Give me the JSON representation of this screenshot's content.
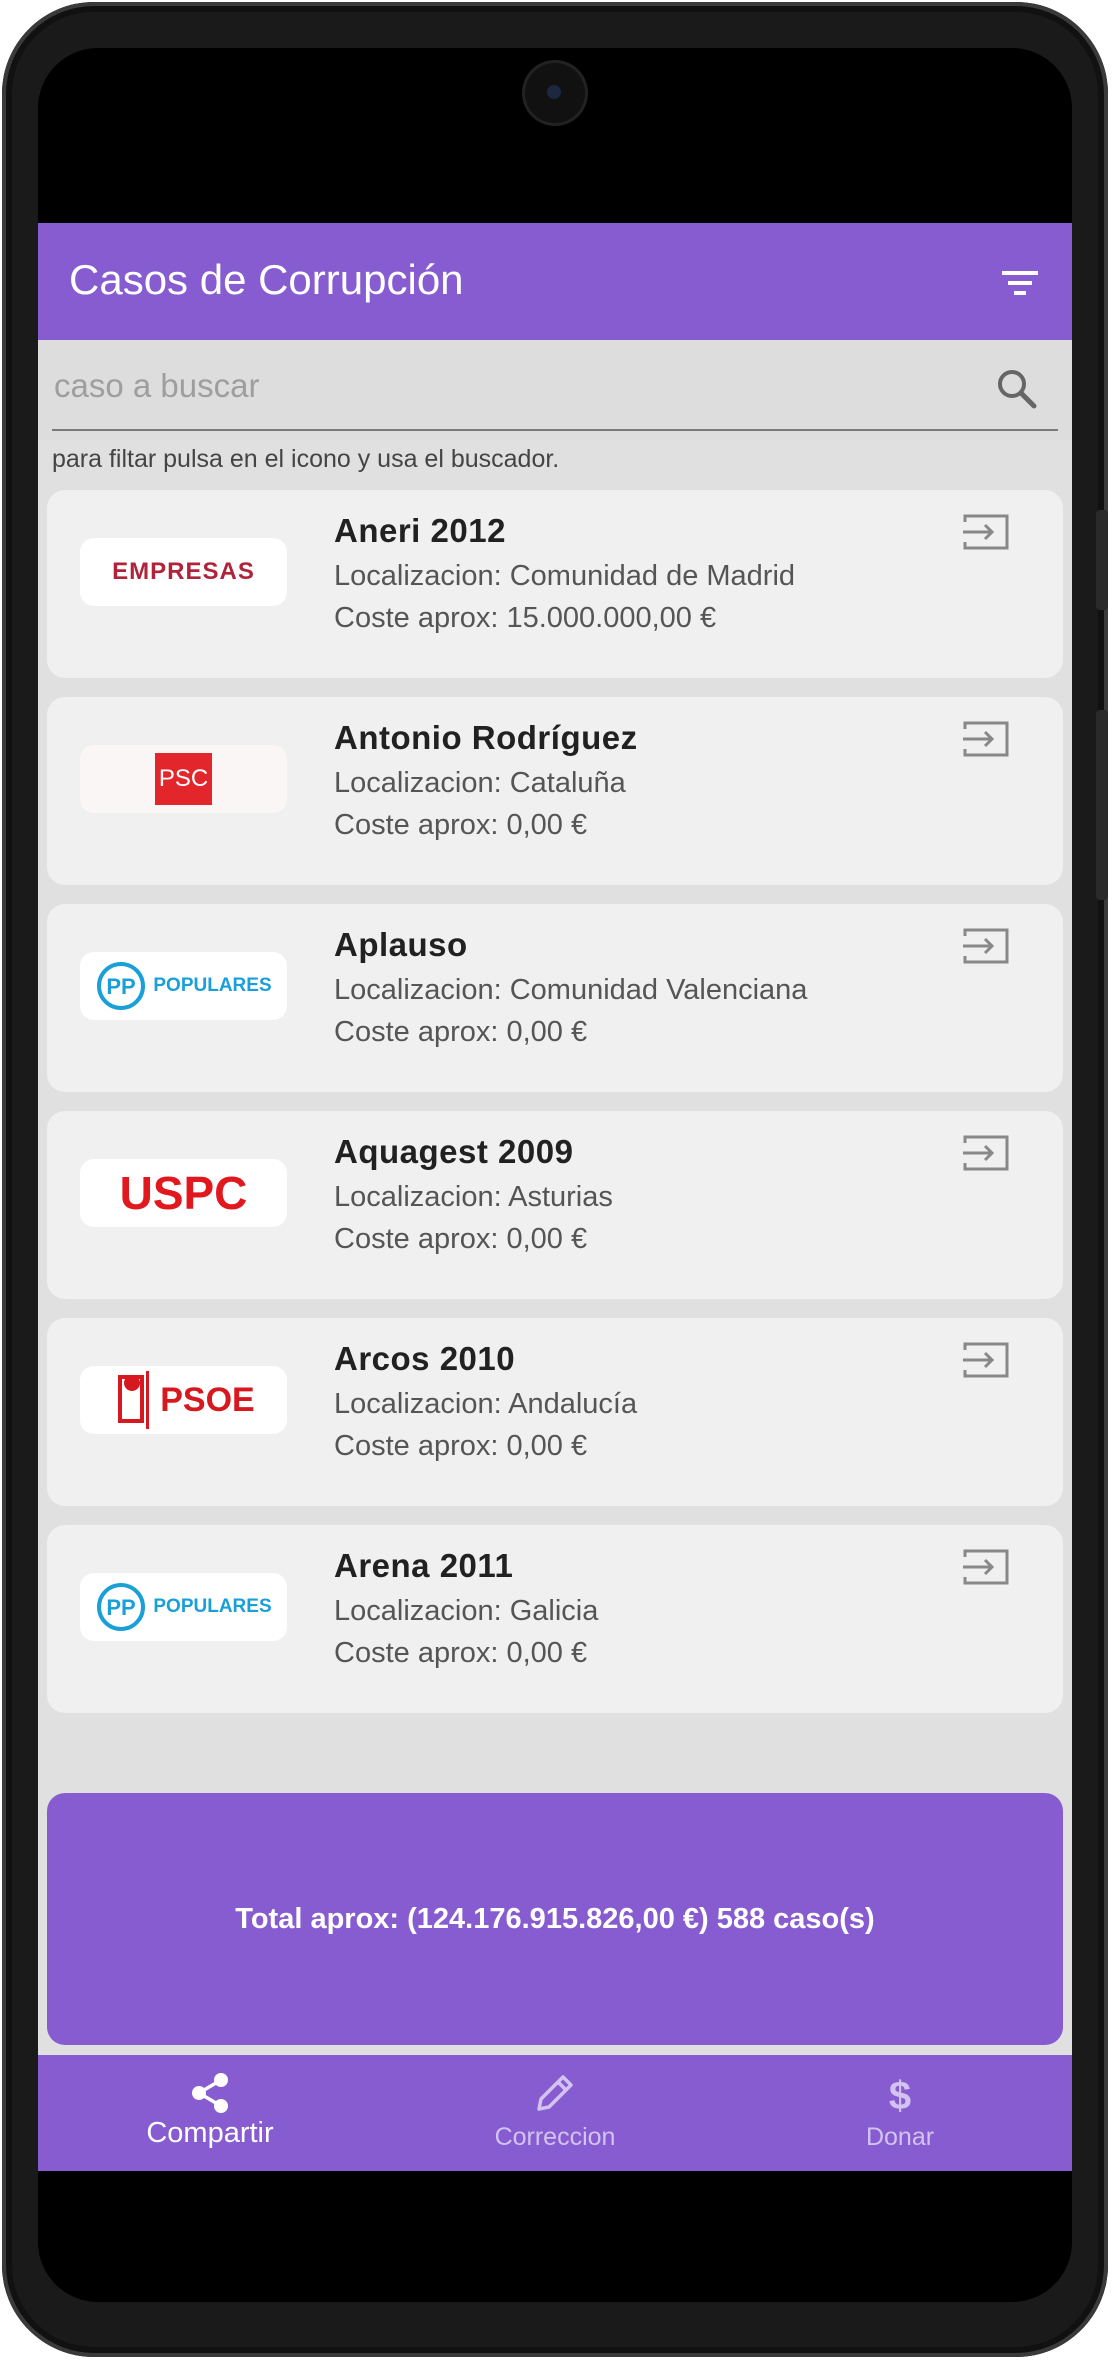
{
  "appbar": {
    "title": "Casos de Corrupción",
    "filter_icon": "filter-list-icon"
  },
  "search": {
    "placeholder": "caso a buscar",
    "value": "",
    "icon": "search-icon",
    "hint": "para filtar pulsa en el icono y usa el buscador."
  },
  "cases": [
    {
      "title": "Aneri 2012",
      "location": "Localizacion: Comunidad de Madrid",
      "cost": "Coste aprox: 15.000.000,00 €",
      "logo_text": "EMPRESAS"
    },
    {
      "title": "Antonio Rodríguez",
      "location": "Localizacion: Cataluña",
      "cost": "Coste aprox: 0,00 €",
      "logo_text": "PSC"
    },
    {
      "title": "Aplauso",
      "location": "Localizacion: Comunidad Valenciana",
      "cost": "Coste aprox: 0,00 €",
      "logo_text": "POPULARES"
    },
    {
      "title": "Aquagest 2009",
      "location": "Localizacion: Asturias",
      "cost": "Coste aprox: 0,00 €",
      "logo_text": "USPC"
    },
    {
      "title": "Arcos 2010",
      "location": "Localizacion: Andalucía",
      "cost": "Coste aprox: 0,00 €",
      "logo_text": "PSOE"
    },
    {
      "title": "Arena 2011",
      "location": "Localizacion: Galicia",
      "cost": "Coste aprox: 0,00 €",
      "logo_text": "POPULARES"
    }
  ],
  "total": {
    "text": "Total aprox: (124.176.915.826,00 €) 588 caso(s)"
  },
  "bottom_nav": [
    {
      "label": "Compartir",
      "icon": "share-icon",
      "active": true
    },
    {
      "label": "Correccion",
      "icon": "pencil-icon",
      "active": false
    },
    {
      "label": "Donar",
      "icon": "dollar-icon",
      "active": false
    }
  ],
  "colors": {
    "primary": "#875cd0",
    "background": "#e0e0e0",
    "card": "#f0f0f0"
  }
}
